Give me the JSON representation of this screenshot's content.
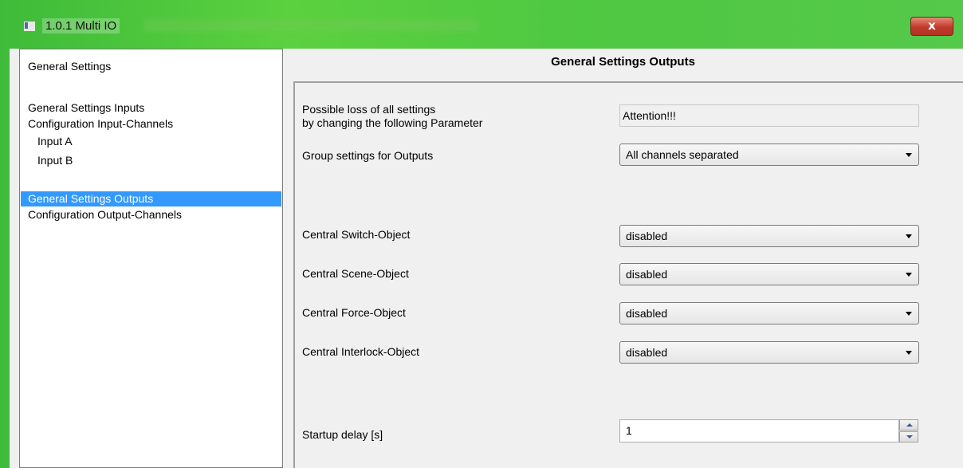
{
  "window": {
    "title": "1.0.1 Multi IO",
    "close_label": "x"
  },
  "nav": {
    "items": [
      {
        "label": "General Settings"
      },
      {
        "label": "General Settings Inputs"
      },
      {
        "label": "Configuration Input-Channels"
      },
      {
        "label": "Input  A"
      },
      {
        "label": "Input  B"
      },
      {
        "label": "General Settings Outputs",
        "selected": true
      },
      {
        "label": "Configuration Output-Channels"
      }
    ]
  },
  "panel": {
    "title": "General Settings Outputs",
    "warning": {
      "label_line1": "Possible loss of all settings",
      "label_line2": "by changing the following Parameter",
      "value": "Attention!!!"
    },
    "params": [
      {
        "label": "Group settings for Outputs",
        "value": "All channels separated"
      },
      {
        "label": "Central Switch-Object",
        "value": "disabled"
      },
      {
        "label": "Central Scene-Object",
        "value": "disabled"
      },
      {
        "label": "Central Force-Object",
        "value": "disabled"
      },
      {
        "label": "Central Interlock-Object",
        "value": "disabled"
      }
    ],
    "startup": {
      "label": "Startup delay [s]",
      "value": "1"
    }
  },
  "colors": {
    "selection": "#3399ff",
    "titlebar": "#4fc842",
    "close": "#c0392b"
  }
}
